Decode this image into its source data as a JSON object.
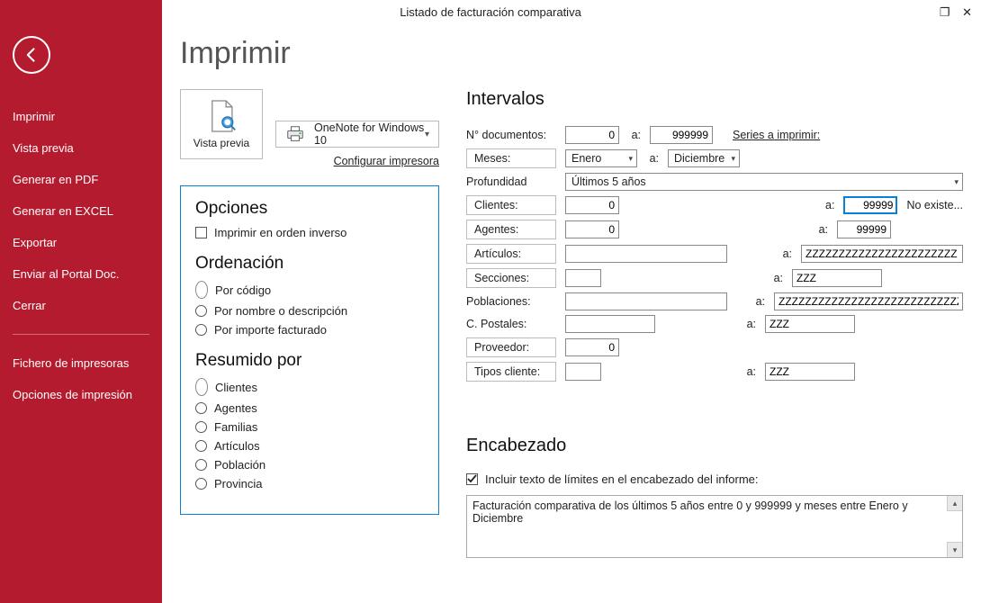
{
  "window": {
    "title": "Listado de facturación comparativa"
  },
  "sidebar": {
    "items": [
      "Imprimir",
      "Vista previa",
      "Generar en PDF",
      "Generar en EXCEL",
      "Exportar",
      "Enviar al Portal Doc.",
      "Cerrar"
    ],
    "items2": [
      "Fichero de impresoras",
      "Opciones de impresión"
    ]
  },
  "page": {
    "title": "Imprimir",
    "preview_label": "Vista previa",
    "printer_name": "OneNote for Windows 10",
    "config_printer": "Configurar impresora"
  },
  "options": {
    "heading": "Opciones",
    "reverse_label": "Imprimir en orden inverso",
    "reverse_checked": false
  },
  "ordering": {
    "heading": "Ordenación",
    "items": [
      {
        "label": "Por código",
        "selected": true
      },
      {
        "label": "Por nombre o descripción",
        "selected": false
      },
      {
        "label": "Por importe facturado",
        "selected": false
      }
    ]
  },
  "summary": {
    "heading": "Resumido por",
    "items": [
      {
        "label": "Clientes",
        "selected": true
      },
      {
        "label": "Agentes",
        "selected": false
      },
      {
        "label": "Familias",
        "selected": false
      },
      {
        "label": "Artículos",
        "selected": false
      },
      {
        "label": "Población",
        "selected": false
      },
      {
        "label": "Provincia",
        "selected": false
      }
    ]
  },
  "intervals": {
    "heading": "Intervalos",
    "docnum_label": "N° documentos:",
    "docnum_from": "0",
    "a": "a:",
    "docnum_to": "999999",
    "series_link": "Series a imprimir:",
    "months_label": "Meses:",
    "month_from": "Enero",
    "month_to": "Diciembre",
    "depth_label": "Profundidad",
    "depth_value": "Últimos 5 años",
    "clients_label": "Clientes:",
    "clients_from": "0",
    "clients_to": "99999",
    "clients_note": "No existe...",
    "agents_label": "Agentes:",
    "agents_from": "0",
    "agents_to": "99999",
    "articles_label": "Artículos:",
    "articles_from": "",
    "articles_to": "ZZZZZZZZZZZZZZZZZZZZZZZ",
    "sections_label": "Secciones:",
    "sections_from": "",
    "sections_to": "ZZZ",
    "towns_label": "Poblaciones:",
    "towns_from": "",
    "towns_to": "ZZZZZZZZZZZZZZZZZZZZZZZZZZZZZZ",
    "postal_label": "C. Postales:",
    "postal_from": "",
    "postal_to": "ZZZ",
    "provider_label": "Proveedor:",
    "provider_from": "0",
    "ctypes_label": "Tipos cliente:",
    "ctypes_from": "",
    "ctypes_to": "ZZZ"
  },
  "header": {
    "heading": "Encabezado",
    "include_label": "Incluir texto de límites en el encabezado del informe:",
    "include_checked": true,
    "text": "Facturación comparativa de los últimos 5 años entre 0 y 999999 y meses entre Enero y Diciembre"
  }
}
